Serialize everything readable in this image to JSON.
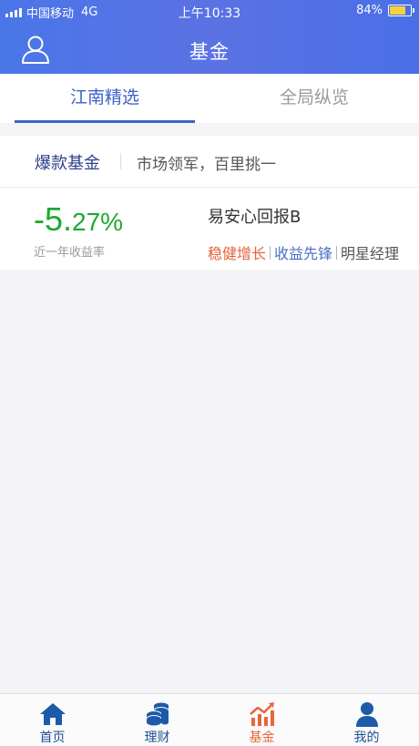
{
  "status_bar": {
    "carrier": "中国移动",
    "network": "4G",
    "time": "上午10:33",
    "battery": "84%",
    "battery_level": 0.84
  },
  "header": {
    "title": "基金",
    "left_icon": "user-icon"
  },
  "tabs": [
    {
      "label": "江南精选",
      "active": true
    },
    {
      "label": "全局纵览",
      "active": false
    }
  ],
  "fund_card": {
    "title": "爆款基金",
    "slogan": "市场领军，百里挑一",
    "rate_int": "-5.",
    "rate_dec": "27%",
    "rate_label": "近一年收益率",
    "fund_name": "易安心回报B",
    "tags": [
      "稳健增长",
      "收益先锋",
      "明星经理"
    ]
  },
  "bottom_nav": [
    {
      "label": "首页",
      "icon": "home-icon"
    },
    {
      "label": "理财",
      "icon": "coins-icon"
    },
    {
      "label": "基金",
      "icon": "chart-icon",
      "active": true
    },
    {
      "label": "我的",
      "icon": "person-icon"
    }
  ],
  "colors": {
    "header_blue": "#4a76e8",
    "active_tab": "#3c63c8",
    "rate_green": "#1caa2f",
    "tag_orange": "#e6633b",
    "tag_blue": "#4a6fc8",
    "nav_active": "#e8663b",
    "nav_blue": "#1d4e94"
  }
}
